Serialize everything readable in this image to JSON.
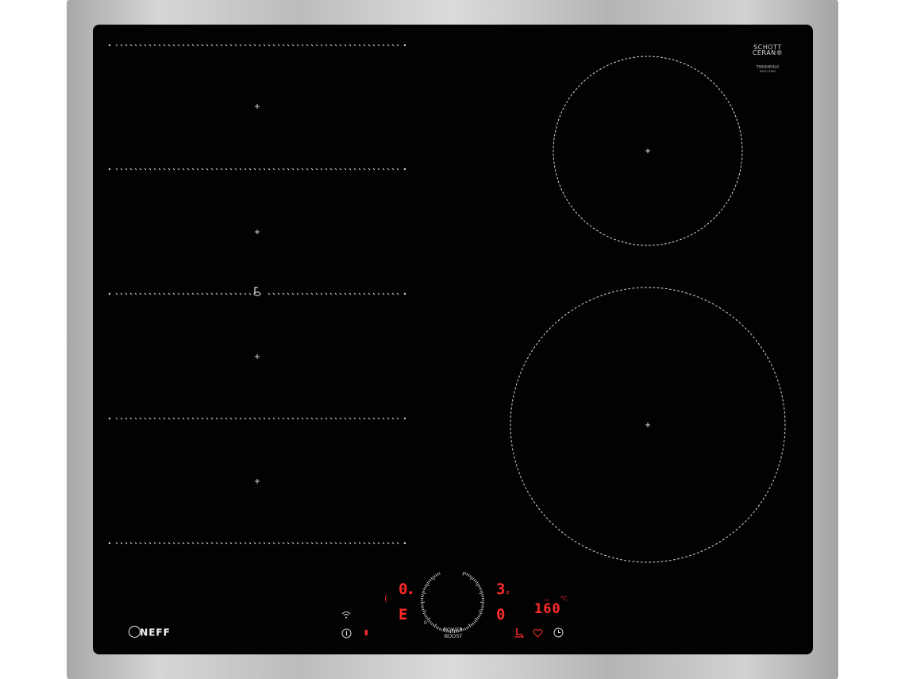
{
  "brand": {
    "logo_text": "NEFF",
    "glass_brand": [
      "SCHOTT",
      "CERAN®"
    ],
    "model_line1": "T66SHE4L0",
    "model_line2": "900117963"
  },
  "controls": {
    "left_display": "0",
    "left_display_2": "E",
    "left_bracket": "(",
    "right_display_top": "3",
    "right_display_top_sub": "₂",
    "right_display_bottom": "0",
    "temp_display": "160",
    "temp_unit": "°C",
    "timer_label": "",
    "power_boost_label": "POWER\nBOOST",
    "dial_zero": "0"
  },
  "icons": {
    "wifi": "wifi-icon",
    "info": "info-icon",
    "pan_sensor": "pan-sensor-icon",
    "heart": "favourite-icon",
    "clock": "timer-icon",
    "key": "lock-icon"
  },
  "colors": {
    "glass": "#020202",
    "display_red": "#ff2a2a",
    "marking": "#d8d8d8"
  }
}
